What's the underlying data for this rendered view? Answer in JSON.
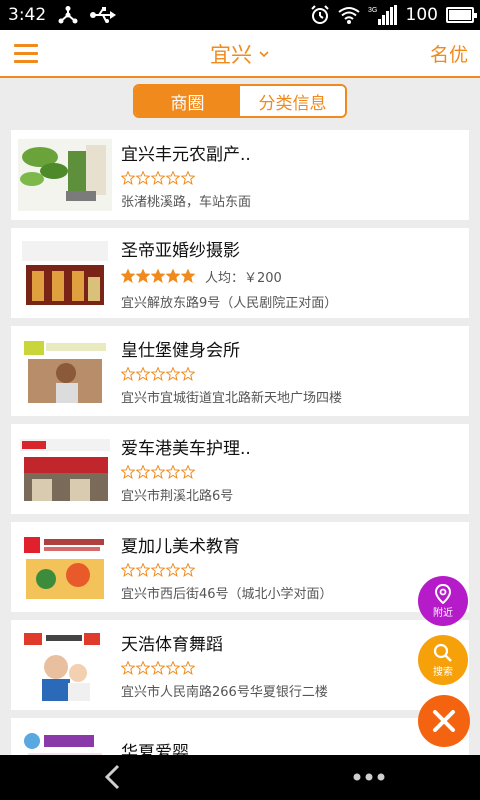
{
  "status_bar": {
    "time": "3:42",
    "battery": "100",
    "battery_level": 1.0,
    "network": "3G",
    "icons": [
      "usb-share-icon",
      "usb-icon",
      "alarm-icon",
      "wifi-icon",
      "signal-icon",
      "battery-icon"
    ]
  },
  "header": {
    "city": "宜兴",
    "right_label": "名优",
    "accent_color": "#f08a1c"
  },
  "segmented": {
    "tabs": [
      "商圈",
      "分类信息"
    ],
    "active_index": 0
  },
  "listings": [
    {
      "name": "宜兴丰元农副产..",
      "rating": 0,
      "avg_price": "",
      "address": "张渚桃溪路，车站东面"
    },
    {
      "name": "圣帝亚婚纱摄影",
      "rating": 5,
      "avg_price": "人均：￥200",
      "address": "宜兴解放东路9号（人民剧院正对面）"
    },
    {
      "name": "皇仕堡健身会所",
      "rating": 0,
      "avg_price": "",
      "address": "宜兴市宜城街道宜北路新天地广场四楼"
    },
    {
      "name": "爱车港美车护理..",
      "rating": 0,
      "avg_price": "",
      "address": "宜兴市荆溪北路6号"
    },
    {
      "name": "夏加儿美术教育",
      "rating": 0,
      "avg_price": "",
      "address": "宜兴市西后街46号（城北小学对面）"
    },
    {
      "name": "天浩体育舞蹈",
      "rating": 0,
      "avg_price": "",
      "address": "宜兴市人民南路266号华夏银行二楼"
    },
    {
      "name": "华夏爱婴",
      "rating": 0,
      "avg_price": "",
      "address": ""
    }
  ],
  "fabs": {
    "nearby_label": "附近",
    "search_label": "搜索"
  },
  "colors": {
    "nearby": "#b51bc9",
    "search": "#f6a10a",
    "close": "#f46410",
    "star": "#f08a1c"
  }
}
